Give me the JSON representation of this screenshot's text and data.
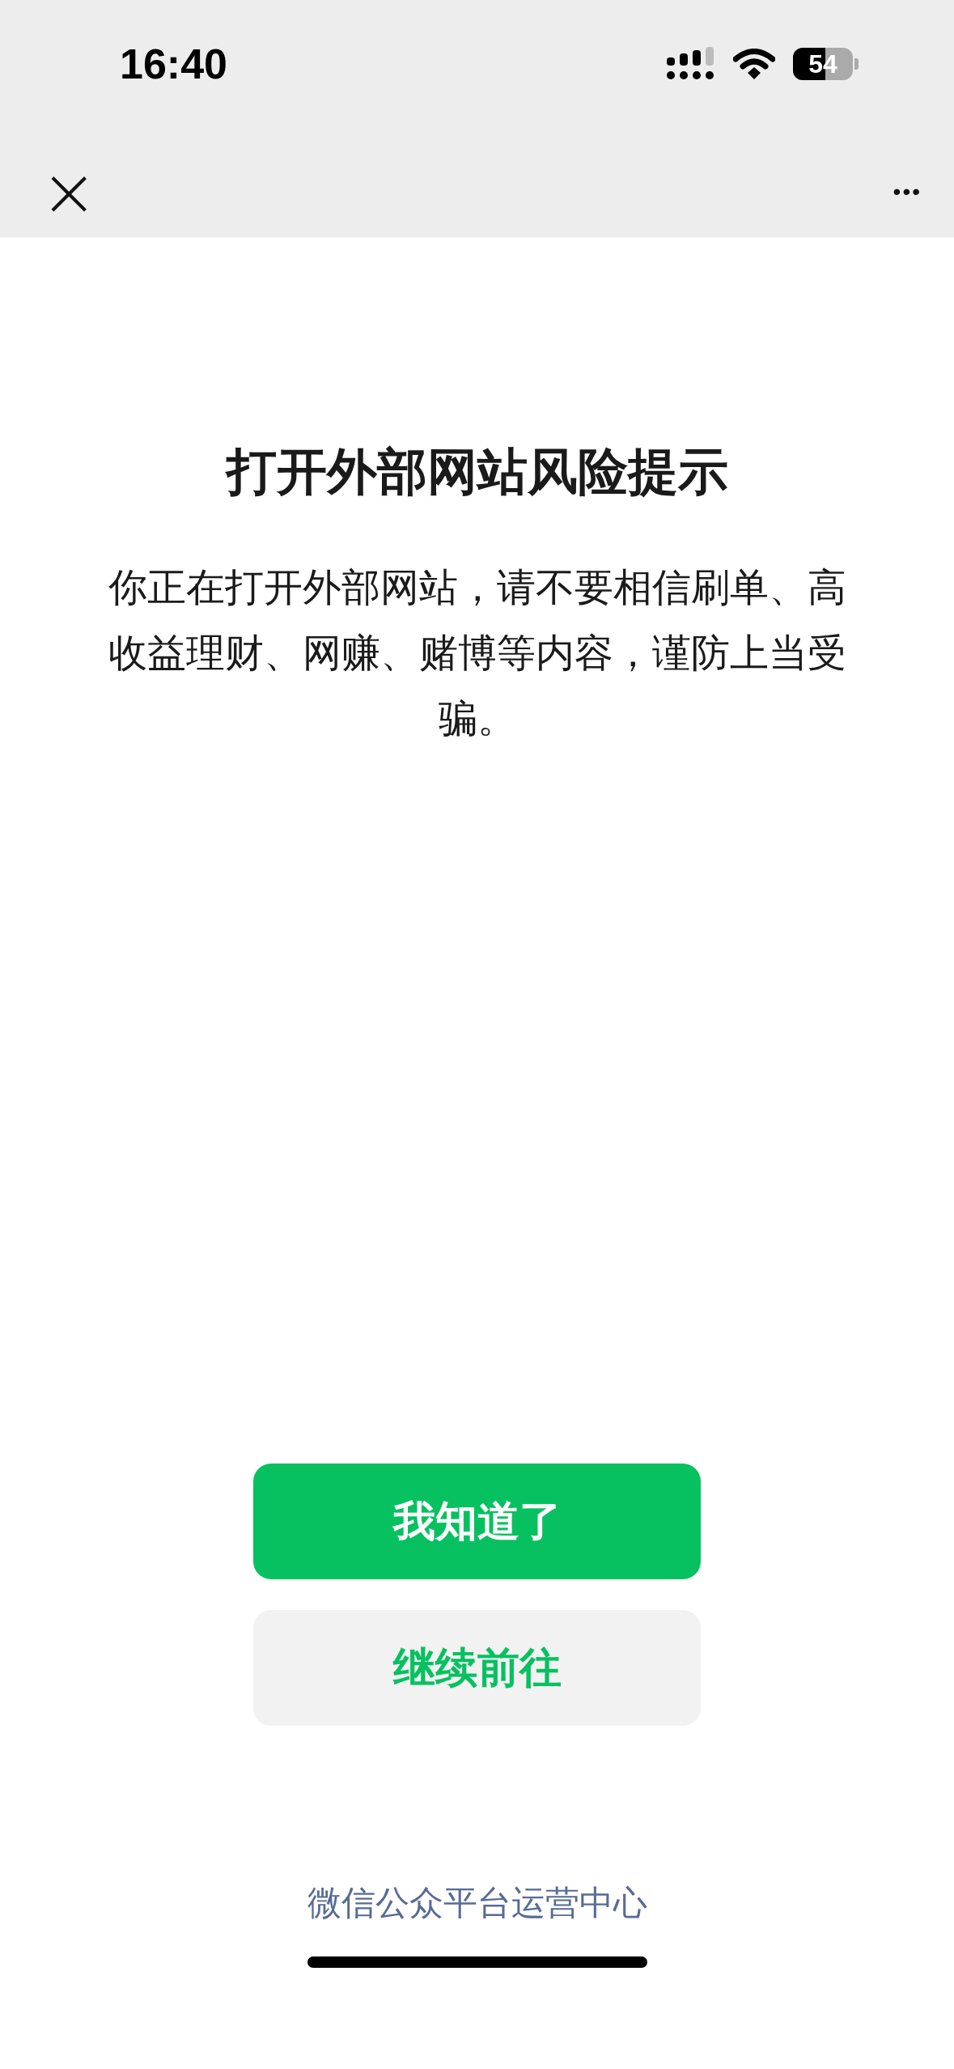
{
  "status_bar": {
    "time": "16:40",
    "battery": "54"
  },
  "nav_bar": {
    "close": "×",
    "more": "•••"
  },
  "title": "打开外部网站风险提示",
  "message": "你正在打开外部网站，请不要相信刷单、高收益理财、网赚、赌博等内容，谨防上当受骗。",
  "buttons": [
    {
      "label": "我知道了",
      "kind": "primary"
    },
    {
      "label": "继续前往",
      "kind": "secondary"
    }
  ],
  "footer": "微信公众平台运营中心"
}
